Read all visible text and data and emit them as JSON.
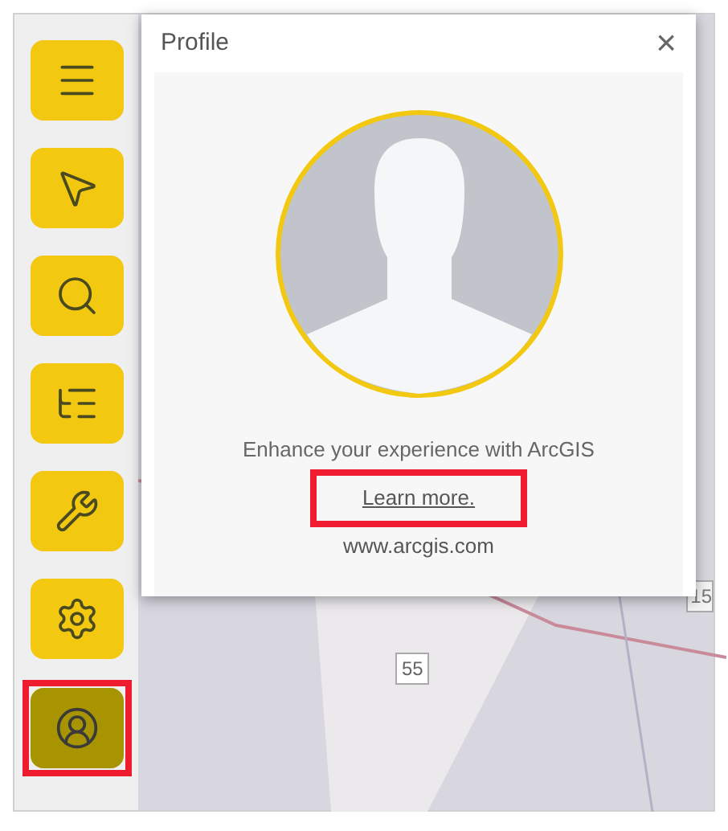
{
  "toolbar": [
    {
      "kind": "menu",
      "selected": false,
      "highlighted": false
    },
    {
      "kind": "select",
      "selected": false,
      "highlighted": false
    },
    {
      "kind": "search",
      "selected": false,
      "highlighted": false
    },
    {
      "kind": "layers",
      "selected": false,
      "highlighted": false
    },
    {
      "kind": "tools",
      "selected": false,
      "highlighted": false
    },
    {
      "kind": "settings",
      "selected": false,
      "highlighted": false
    },
    {
      "kind": "profile",
      "selected": true,
      "highlighted": true
    }
  ],
  "popup": {
    "title": "Profile",
    "close": "×",
    "message": "Enhance your experience with ArcGIS",
    "link": {
      "text": "Learn more.",
      "highlighted": true
    },
    "website": "www.arcgis.com"
  },
  "map": {
    "labels": [
      "55",
      "15"
    ]
  }
}
